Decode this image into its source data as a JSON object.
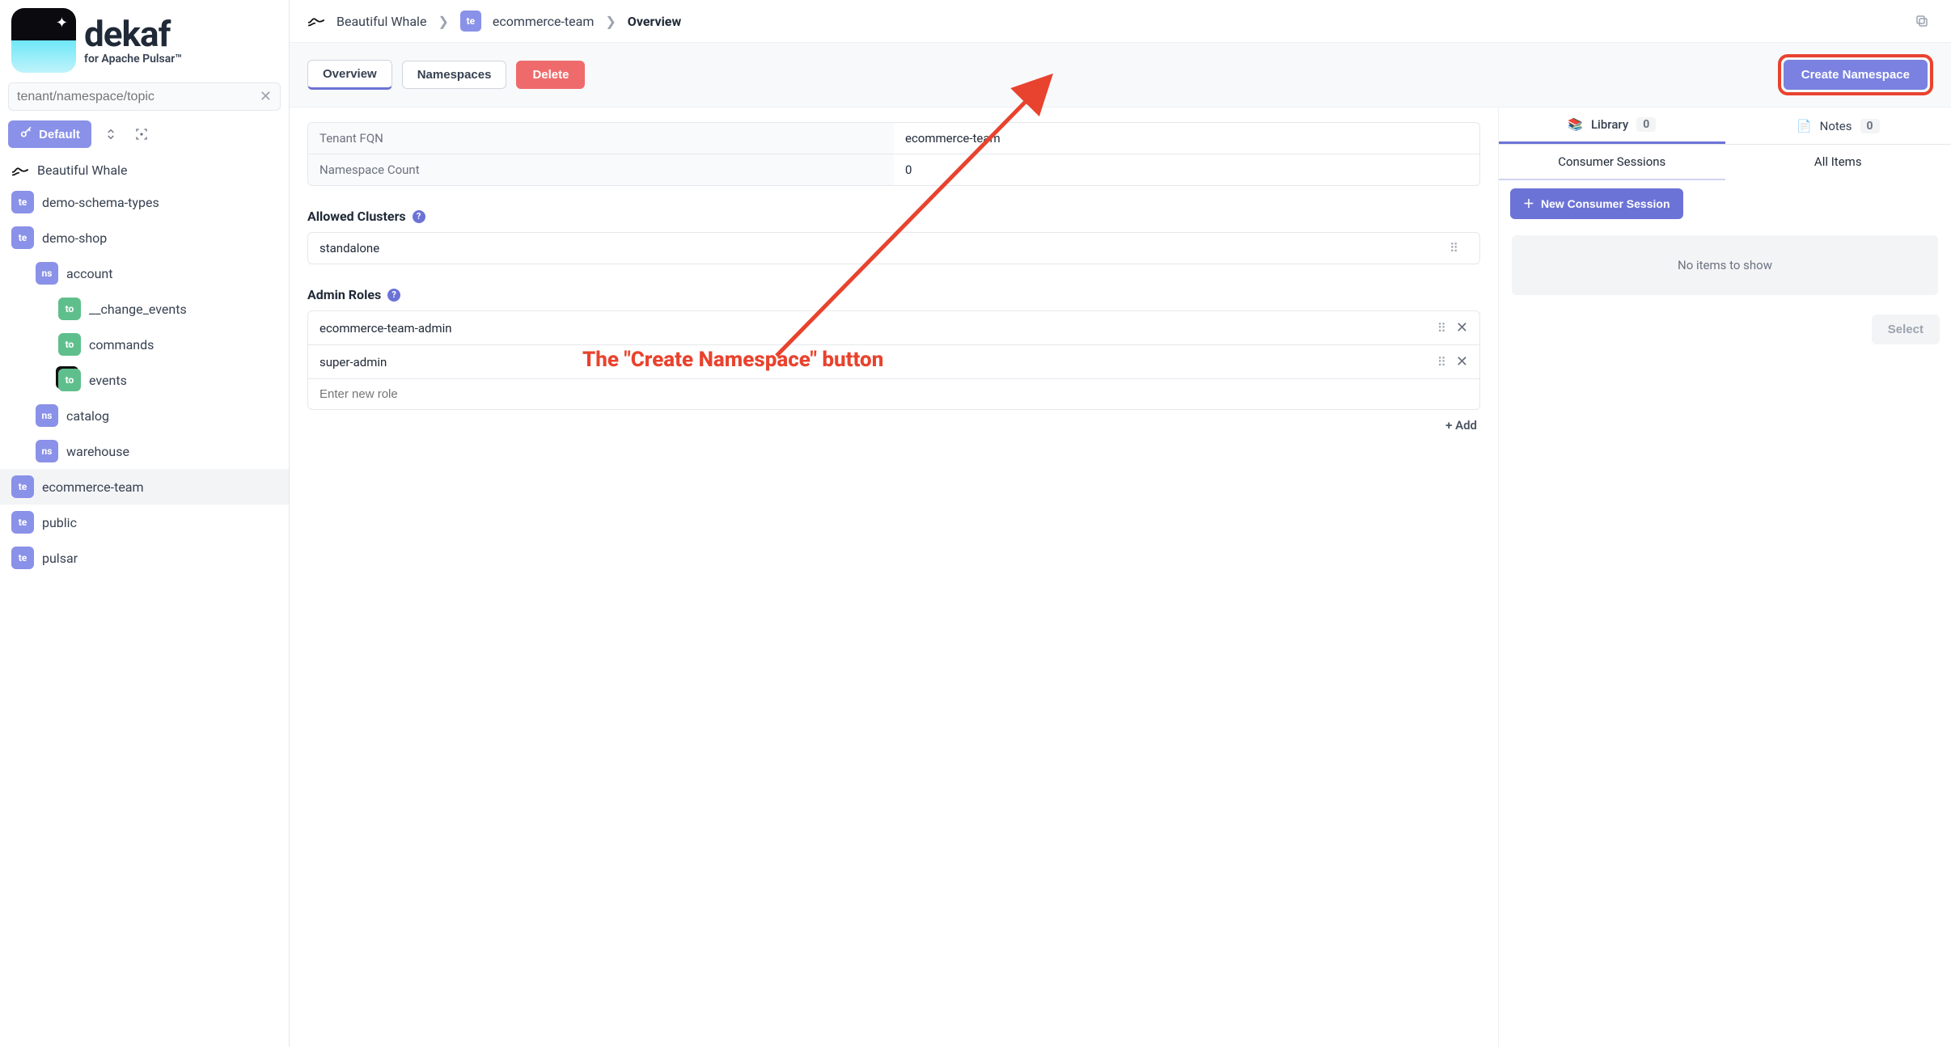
{
  "brand": {
    "name": "dekaf",
    "tagline": "for Apache Pulsar™"
  },
  "search": {
    "placeholder": "tenant/namespace/topic"
  },
  "defaultButton": "Default",
  "connectionName": "Beautiful Whale",
  "tree": [
    {
      "type": "root",
      "label": "Beautiful Whale"
    },
    {
      "type": "te",
      "label": "demo-schema-types",
      "indent": 1
    },
    {
      "type": "te",
      "label": "demo-shop",
      "indent": 1
    },
    {
      "type": "ns",
      "label": "account",
      "indent": 2
    },
    {
      "type": "to",
      "label": "__change_events",
      "indent": 3
    },
    {
      "type": "to",
      "label": "commands",
      "indent": 3
    },
    {
      "type": "to",
      "label": "events",
      "indent": 3,
      "sup": true
    },
    {
      "type": "ns",
      "label": "catalog",
      "indent": 2
    },
    {
      "type": "ns",
      "label": "warehouse",
      "indent": 2
    },
    {
      "type": "te",
      "label": "ecommerce-team",
      "indent": 1,
      "active": true
    },
    {
      "type": "te",
      "label": "public",
      "indent": 1
    },
    {
      "type": "te",
      "label": "pulsar",
      "indent": 1
    }
  ],
  "breadcrumb": {
    "root": "Beautiful Whale",
    "tenantBadge": "te",
    "tenant": "ecommerce-team",
    "current": "Overview"
  },
  "tabs": {
    "overview": "Overview",
    "namespaces": "Namespaces",
    "delete": "Delete",
    "createNamespace": "Create Namespace"
  },
  "info": {
    "fqnLabel": "Tenant FQN",
    "fqnValue": "ecommerce-team",
    "nsCountLabel": "Namespace Count",
    "nsCountValue": "0"
  },
  "allowedClusters": {
    "title": "Allowed Clusters",
    "items": [
      "standalone"
    ]
  },
  "adminRoles": {
    "title": "Admin Roles",
    "items": [
      "ecommerce-team-admin",
      "super-admin"
    ],
    "placeholder": "Enter new role",
    "addLabel": "+  Add"
  },
  "rightPanel": {
    "library": "Library",
    "libraryCount": "0",
    "notes": "Notes",
    "notesCount": "0",
    "consumerSessions": "Consumer Sessions",
    "allItems": "All Items",
    "newSession": "New Consumer Session",
    "empty": "No items to show",
    "select": "Select"
  },
  "annotation": "The \"Create Namespace\" button"
}
